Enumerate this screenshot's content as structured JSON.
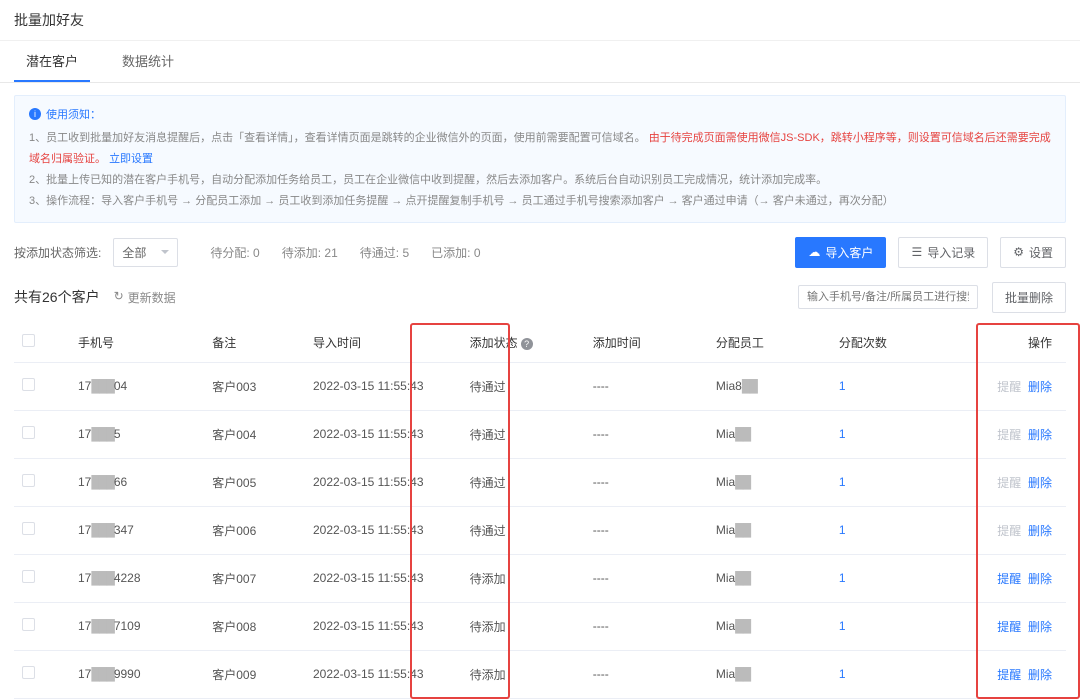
{
  "page": {
    "title": "批量加好友"
  },
  "tabs": [
    {
      "label": "潜在客户",
      "active": true
    },
    {
      "label": "数据统计",
      "active": false
    }
  ],
  "notice": {
    "title": "使用须知：",
    "line1_a": "1、员工收到批量加好友消息提醒后，点击「查看详情」，查看详情页面是跳转的企业微信外的页面，使用前需要配置可信域名。",
    "line1_red": "由于待完成页面需使用微信JS-SDK，跳转小程序等，则设置可信域名后还需要完成域名归属验证。",
    "line1_link": "立即设置",
    "line2": "2、批量上传已知的潜在客户手机号，自动分配添加任务给员工，员工在企业微信中收到提醒，然后去添加客户。系统后台自动识别员工完成情况，统计添加完成率。",
    "line3": "3、操作流程：导入客户手机号 → 分配员工添加 → 员工收到添加任务提醒 → 点开提醒复制手机号 → 员工通过手机号搜索添加客户 → 客户通过申请（→ 客户未通过，再次分配）"
  },
  "filter": {
    "label": "按添加状态筛选:",
    "selected": "全部",
    "stats": [
      {
        "label": "待分配:",
        "value": "0"
      },
      {
        "label": "待添加:",
        "value": "21"
      },
      {
        "label": "待通过:",
        "value": "5"
      },
      {
        "label": "已添加:",
        "value": "0"
      }
    ],
    "import_btn": "导入客户",
    "record_btn": "导入记录",
    "settings_btn": "设置"
  },
  "summary": {
    "title": "共有26个客户",
    "refresh": "更新数据",
    "search_placeholder": "输入手机号/备注/所属员工进行搜索",
    "bulk_delete": "批量删除"
  },
  "table": {
    "cols": {
      "phone": "手机号",
      "remark": "备注",
      "import_time": "导入时间",
      "add_status": "添加状态",
      "add_time": "添加时间",
      "assignee": "分配员工",
      "assign_count": "分配次数",
      "ops": "操作"
    },
    "op_remind": "提醒",
    "op_delete": "删除",
    "rows": [
      {
        "phone_p": "17",
        "phone_s": "04",
        "remark": "客户003",
        "import_time": "2022-03-15 11:55:43",
        "add_status": "待通过",
        "add_time": "----",
        "assignee": "Mia8",
        "assign_count": "1",
        "remind_enabled": false
      },
      {
        "phone_p": "17",
        "phone_s": "5",
        "remark": "客户004",
        "import_time": "2022-03-15 11:55:43",
        "add_status": "待通过",
        "add_time": "----",
        "assignee": "Mia",
        "assign_count": "1",
        "remind_enabled": false
      },
      {
        "phone_p": "17",
        "phone_s": "66",
        "remark": "客户005",
        "import_time": "2022-03-15 11:55:43",
        "add_status": "待通过",
        "add_time": "----",
        "assignee": "Mia",
        "assign_count": "1",
        "remind_enabled": false
      },
      {
        "phone_p": "17",
        "phone_s": "347",
        "remark": "客户006",
        "import_time": "2022-03-15 11:55:43",
        "add_status": "待通过",
        "add_time": "----",
        "assignee": "Mia",
        "assign_count": "1",
        "remind_enabled": false
      },
      {
        "phone_p": "17",
        "phone_s": "4228",
        "remark": "客户007",
        "import_time": "2022-03-15 11:55:43",
        "add_status": "待添加",
        "add_time": "----",
        "assignee": "Mia",
        "assign_count": "1",
        "remind_enabled": true
      },
      {
        "phone_p": "17",
        "phone_s": "7109",
        "remark": "客户008",
        "import_time": "2022-03-15 11:55:43",
        "add_status": "待添加",
        "add_time": "----",
        "assignee": "Mia",
        "assign_count": "1",
        "remind_enabled": true
      },
      {
        "phone_p": "17",
        "phone_s": "9990",
        "remark": "客户009",
        "import_time": "2022-03-15 11:55:43",
        "add_status": "待添加",
        "add_time": "----",
        "assignee": "Mia",
        "assign_count": "1",
        "remind_enabled": true
      }
    ]
  }
}
